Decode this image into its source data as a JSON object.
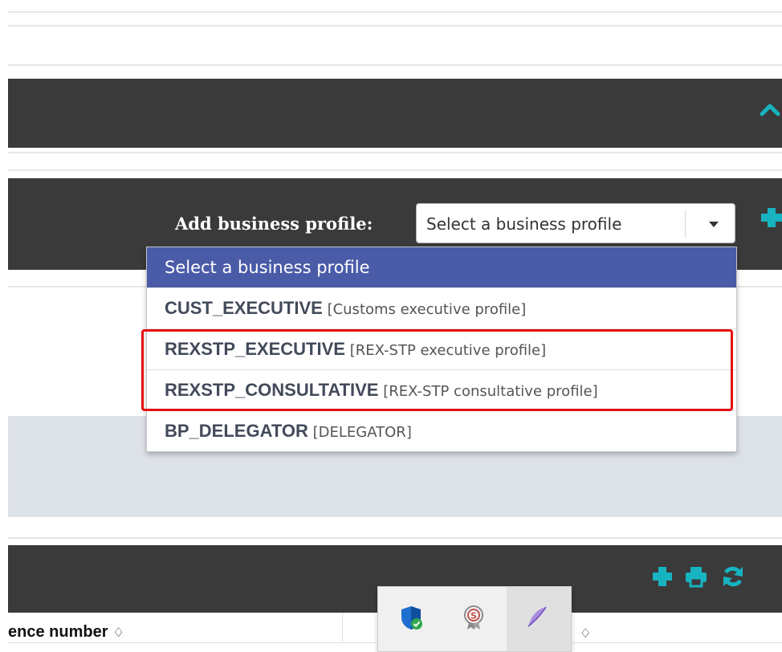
{
  "business_profile": {
    "label": "Add business profile:",
    "selected_value": "Select a business profile",
    "options": [
      {
        "code": "",
        "description": "Select a business profile",
        "selected": true
      },
      {
        "code": "CUST_EXECUTIVE",
        "description": "[Customs executive profile]"
      },
      {
        "code": "REXSTP_EXECUTIVE",
        "description": "[REX-STP executive profile]"
      },
      {
        "code": "REXSTP_CONSULTATIVE",
        "description": "[REX-STP consultative profile]"
      },
      {
        "code": "BP_DELEGATOR",
        "description": "[DELEGATOR]"
      }
    ]
  },
  "table": {
    "col1_header": "ence number",
    "sort_symbol": "♢"
  },
  "icons": {
    "collapse": "chevron-up-icon",
    "add": "plus-icon",
    "print": "print-icon",
    "refresh": "refresh-icon",
    "tray": [
      "shield-icon",
      "certificate-icon",
      "feather-icon"
    ]
  },
  "colors": {
    "panel_bg": "#3a3a3a",
    "accent": "#17b3c1",
    "selected_option_bg": "#4a5ba8",
    "highlight": "#e31010",
    "gray_band": "#dde2e8"
  }
}
